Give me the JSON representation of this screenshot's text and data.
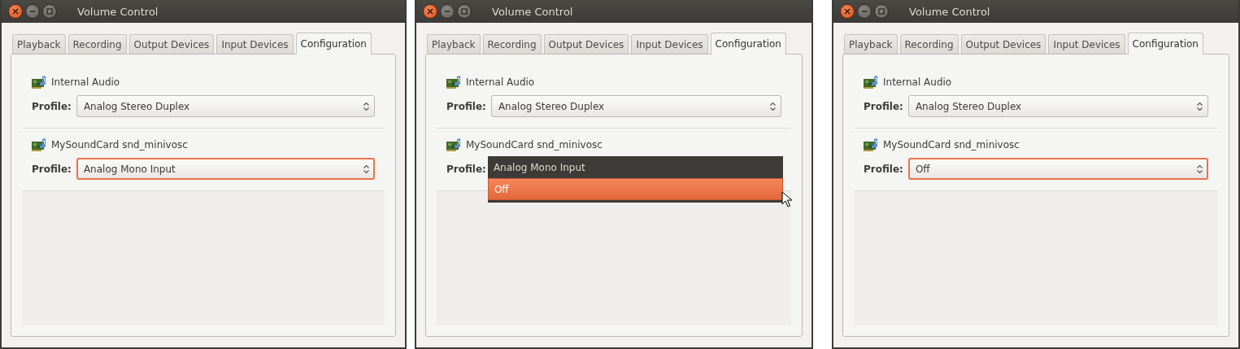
{
  "windows": [
    {
      "title": "Volume Control",
      "tabs": [
        {
          "label": "Playback",
          "selected": false
        },
        {
          "label": "Recording",
          "selected": false
        },
        {
          "label": "Output Devices",
          "selected": false
        },
        {
          "label": "Input Devices",
          "selected": false
        },
        {
          "label": "Configuration",
          "selected": true
        }
      ],
      "cards": [
        {
          "name": "Internal Audio",
          "profile_label": "Profile:",
          "profile": "Analog Stereo Duplex",
          "focused": false
        },
        {
          "name": "MySoundCard snd_minivosc",
          "profile_label": "Profile:",
          "profile": "Analog Mono Input",
          "focused": true
        }
      ]
    },
    {
      "title": "Volume Control",
      "pointer": true,
      "tabs": [
        {
          "label": "Playback",
          "selected": false
        },
        {
          "label": "Recording",
          "selected": false
        },
        {
          "label": "Output Devices",
          "selected": false
        },
        {
          "label": "Input Devices",
          "selected": false
        },
        {
          "label": "Configuration",
          "selected": true
        }
      ],
      "cards": [
        {
          "name": "Internal Audio",
          "profile_label": "Profile:",
          "profile": "Analog Stereo Duplex",
          "focused": false
        },
        {
          "name": "MySoundCard snd_minivosc",
          "profile_label": "Profile:",
          "menu": [
            {
              "label": "Analog Mono Input",
              "selected": false
            },
            {
              "label": "Off",
              "selected": true
            }
          ]
        }
      ]
    },
    {
      "title": "Volume Control",
      "tabs": [
        {
          "label": "Playback",
          "selected": false
        },
        {
          "label": "Recording",
          "selected": false
        },
        {
          "label": "Output Devices",
          "selected": false
        },
        {
          "label": "Input Devices",
          "selected": false
        },
        {
          "label": "Configuration",
          "selected": true
        }
      ],
      "cards": [
        {
          "name": "Internal Audio",
          "profile_label": "Profile:",
          "profile": "Analog Stereo Duplex",
          "focused": false
        },
        {
          "name": "MySoundCard snd_minivosc",
          "profile_label": "Profile:",
          "profile": "Off",
          "focused": true
        }
      ]
    }
  ]
}
